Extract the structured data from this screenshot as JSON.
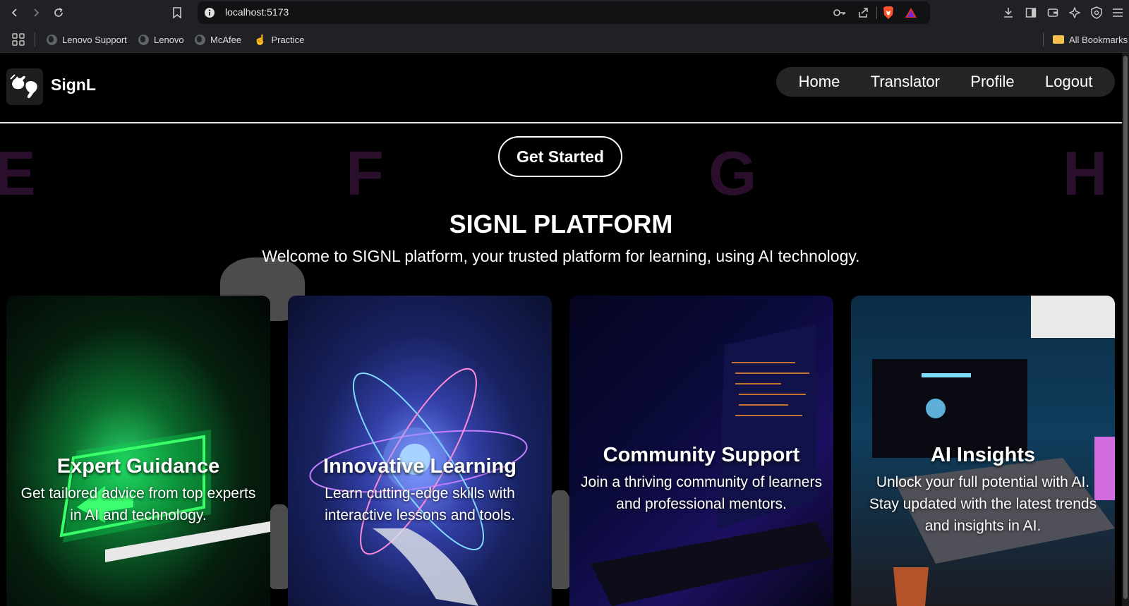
{
  "browser": {
    "url": "localhost:5173",
    "bookmarks": [
      "Lenovo Support",
      "Lenovo",
      "McAfee",
      "Practice"
    ],
    "all_bookmarks_label": "All Bookmarks"
  },
  "header": {
    "brand": "SignL",
    "nav": [
      "Home",
      "Translator",
      "Profile",
      "Logout"
    ]
  },
  "hero": {
    "cta": "Get Started",
    "bg_letters": [
      "E",
      "F",
      "G",
      "H"
    ],
    "title": "SIGNL PLATFORM",
    "subtitle": "Welcome to SIGNL platform, your trusted platform for learning, using AI technology."
  },
  "cards": [
    {
      "title": "Expert Guidance",
      "desc": "Get tailored advice from top experts in AI and technology."
    },
    {
      "title": "Innovative Learning",
      "desc": "Learn cutting-edge skills with interactive lessons and tools."
    },
    {
      "title": "Community Support",
      "desc": "Join a thriving community of learners and professional mentors."
    },
    {
      "title": "AI Insights",
      "desc": "Unlock your full potential with AI. Stay updated with the latest trends and insights in AI."
    }
  ],
  "icons": {
    "back": "back-icon",
    "forward": "forward-icon",
    "reload": "reload-icon",
    "bookmark": "bookmark-icon",
    "site_info": "info-icon",
    "key": "key-icon",
    "share": "share-icon",
    "brave": "brave-shield-icon",
    "rewards": "brave-rewards-icon",
    "download": "download-icon",
    "sidebar": "sidebar-icon",
    "wallet": "wallet-icon",
    "extensions": "extensions-icon",
    "vpn": "vpn-icon",
    "menu": "menu-icon",
    "apps": "apps-grid-icon",
    "folder": "folder-icon",
    "logo": "sign-hand-icon"
  },
  "colors": {
    "accent_brave": "#fb542b",
    "bg_letter": "#2a0f2c",
    "nav_pill": "#242424"
  }
}
